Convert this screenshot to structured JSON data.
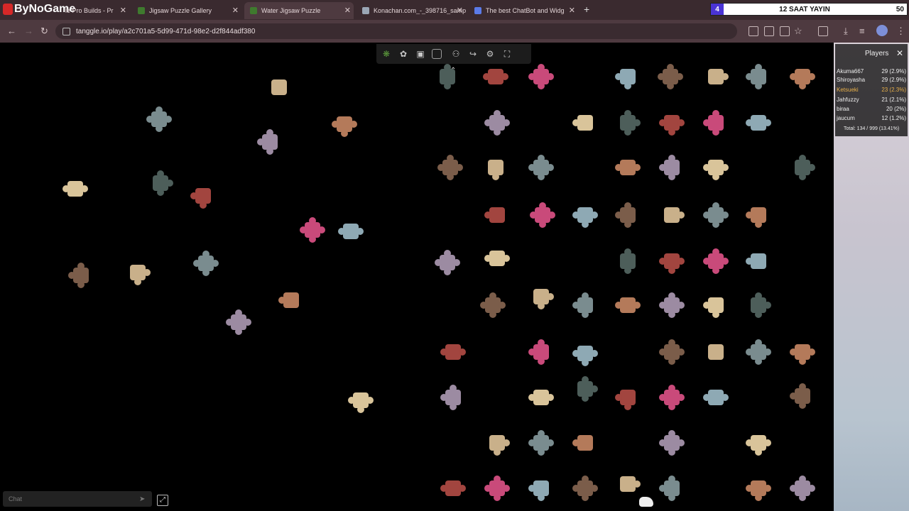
{
  "browser": {
    "logo_text": "ByNoGame",
    "tabs": [
      {
        "title": "le Pro Builds - Pr",
        "active": false,
        "color": "#e34b2e"
      },
      {
        "title": "Jigsaw Puzzle Gallery",
        "active": false,
        "color": "#3f7a2e"
      },
      {
        "title": "Water Jigsaw Puzzle",
        "active": true,
        "color": "#3f7a2e"
      },
      {
        "title": "Konachan.com_-_398716_samp",
        "active": false,
        "color": "#9aa6b5"
      },
      {
        "title": "The best ChatBot and Widg",
        "active": false,
        "color": "#5b7be8"
      }
    ],
    "url": "tanggle.io/play/a2c701a5-5d99-471d-98e2-d2f844adf380"
  },
  "stream_bar": {
    "left": "4",
    "center": "12 SAAT YAYIN",
    "right": "50"
  },
  "players_panel": {
    "title": "Players",
    "players": [
      {
        "name": "Akuma667",
        "score": "29 (2.9%)"
      },
      {
        "name": "Shiroyasha",
        "score": "29 (2.9%)"
      },
      {
        "name": "Ketsueki",
        "score": "23 (2.3%)"
      },
      {
        "name": "Jahfuzzy",
        "score": "21 (2.1%)"
      },
      {
        "name": "biraa",
        "score": "20 (2%)"
      },
      {
        "name": "jaucum",
        "score": "12 (1.2%)"
      }
    ],
    "total": "Total: 134 / 999 (13.41%)"
  },
  "chat": {
    "placeholder": "Chat"
  },
  "icons": {
    "back": "arrow-left-icon",
    "forward": "arrow-right-icon",
    "reload": "reload-icon",
    "send": "send-icon",
    "expand": "expand-icon",
    "close": "close-icon"
  }
}
